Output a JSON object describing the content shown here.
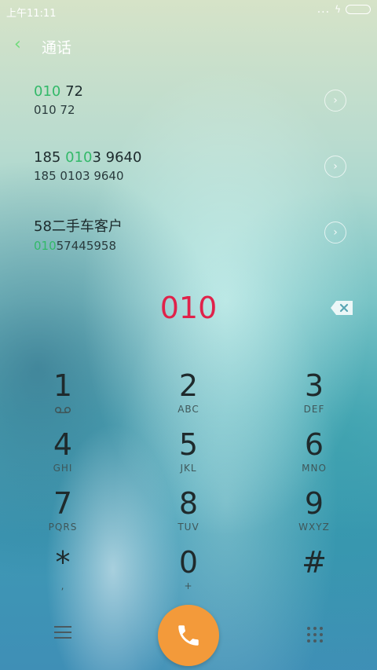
{
  "status_bar": {
    "time": "上午11:11",
    "more": "..."
  },
  "header": {
    "title": "通话"
  },
  "results": [
    {
      "name_pre": "",
      "name_hl": "010",
      "name_post": " 72",
      "num_pre": "",
      "num_hl": "",
      "num_post": "010 72"
    },
    {
      "name_pre": "185 ",
      "name_hl": "010",
      "name_post": "3 9640",
      "num_pre": "",
      "num_hl": "",
      "num_post": "185 0103 9640"
    },
    {
      "name_pre": "58二手车客户",
      "name_hl": "",
      "name_post": "",
      "num_pre": "",
      "num_hl": "010",
      "num_post": "57445958"
    }
  ],
  "dial_display": "010",
  "keypad": [
    {
      "digit": "1",
      "letters": ""
    },
    {
      "digit": "2",
      "letters": "ABC"
    },
    {
      "digit": "3",
      "letters": "DEF"
    },
    {
      "digit": "4",
      "letters": "GHI"
    },
    {
      "digit": "5",
      "letters": "JKL"
    },
    {
      "digit": "6",
      "letters": "MNO"
    },
    {
      "digit": "7",
      "letters": "PQRS"
    },
    {
      "digit": "8",
      "letters": "TUV"
    },
    {
      "digit": "9",
      "letters": "WXYZ"
    },
    {
      "digit": "*",
      "letters": ","
    },
    {
      "digit": "0",
      "letters": "+"
    },
    {
      "digit": "#",
      "letters": ""
    }
  ],
  "colors": {
    "accent": "#33b969",
    "dial_text": "#e0224a",
    "call_button": "#f39a3a"
  },
  "icons": {
    "voicemail": "voicemail-icon",
    "backspace": "backspace-icon",
    "menu": "menu-icon",
    "call": "phone-icon",
    "dialpad": "dialpad-grid-icon"
  }
}
